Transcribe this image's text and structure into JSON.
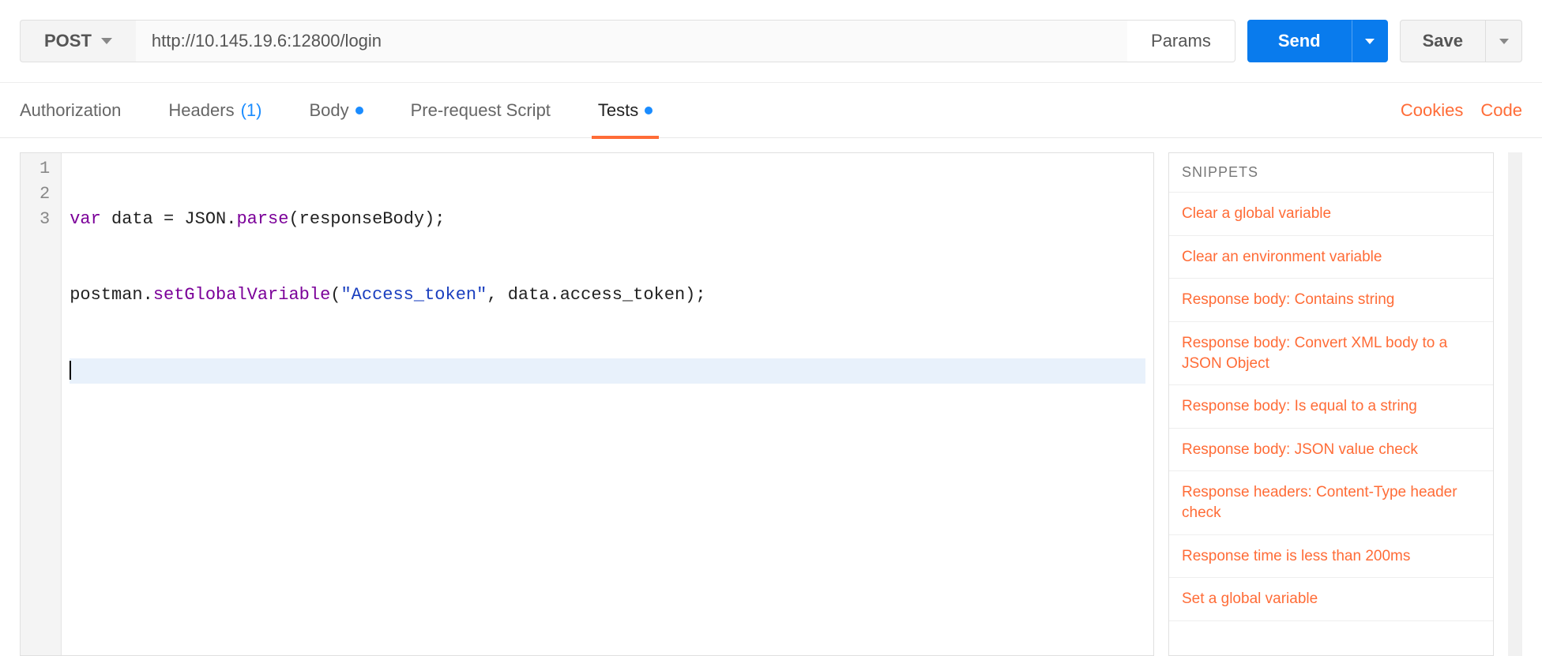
{
  "request": {
    "method": "POST",
    "url": "http://10.145.19.6:12800/login",
    "params_label": "Params",
    "send_label": "Send",
    "save_label": "Save"
  },
  "tabs": {
    "authorization": "Authorization",
    "headers": "Headers",
    "headers_count": "(1)",
    "body": "Body",
    "prerequest": "Pre-request Script",
    "tests": "Tests",
    "cookies_link": "Cookies",
    "code_link": "Code"
  },
  "editor": {
    "lines": {
      "1": {
        "num": "1"
      },
      "2": {
        "num": "2"
      },
      "3": {
        "num": "3"
      }
    },
    "code": {
      "l1_kw": "var",
      "l1_rest": " data = JSON.",
      "l1_fn": "parse",
      "l1_tail": "(responseBody);",
      "l2_a": "postman.",
      "l2_fn": "setGlobalVariable",
      "l2_paren": "(",
      "l2_str": "\"Access_token\"",
      "l2_tail": ", data.access_token);"
    }
  },
  "snippets": {
    "header": "SNIPPETS",
    "items": [
      "Clear a global variable",
      "Clear an environment variable",
      "Response body: Contains string",
      "Response body: Convert XML body to a JSON Object",
      "Response body: Is equal to a string",
      "Response body: JSON value check",
      "Response headers: Content-Type header check",
      "Response time is less than 200ms",
      "Set a global variable"
    ]
  },
  "colors": {
    "orange": "#ff6c37",
    "blue": "#097BED"
  }
}
